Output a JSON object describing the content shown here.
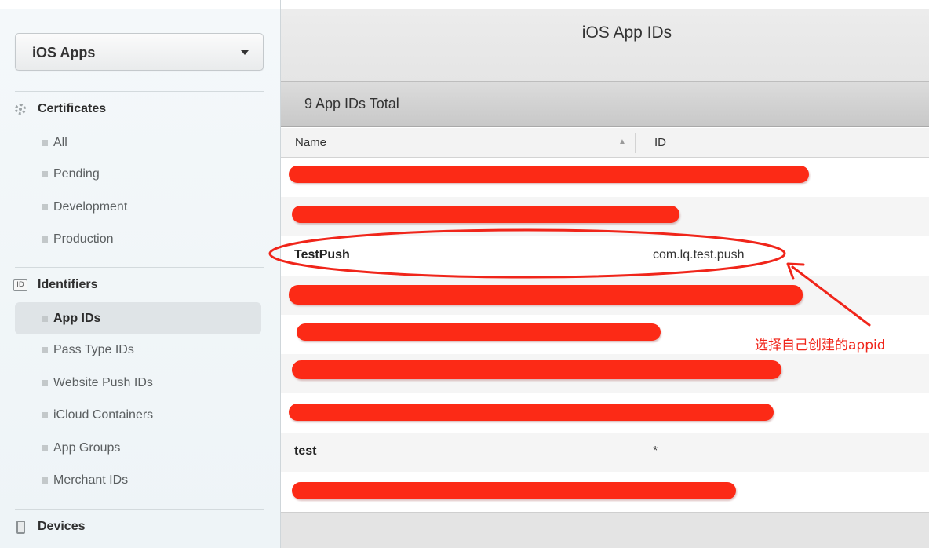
{
  "sidebar": {
    "dropdown": {
      "label": "iOS Apps"
    },
    "sections": [
      {
        "title": "Certificates",
        "icon": "certificate-gear-icon",
        "items": [
          {
            "label": "All"
          },
          {
            "label": "Pending"
          },
          {
            "label": "Development"
          },
          {
            "label": "Production"
          }
        ]
      },
      {
        "title": "Identifiers",
        "icon": "id-badge-icon",
        "icon_text": "ID",
        "items": [
          {
            "label": "App IDs",
            "active": true
          },
          {
            "label": "Pass Type IDs"
          },
          {
            "label": "Website Push IDs"
          },
          {
            "label": "iCloud Containers"
          },
          {
            "label": "App Groups"
          },
          {
            "label": "Merchant IDs"
          }
        ]
      },
      {
        "title": "Devices",
        "icon": "device-icon"
      }
    ]
  },
  "main": {
    "title": "iOS App IDs",
    "count_label": "9 App IDs Total",
    "columns": {
      "name": "Name",
      "id": "ID",
      "sort_indicator": "▲"
    },
    "rows": [
      {
        "name": "",
        "id": "",
        "redacted": true
      },
      {
        "name": "",
        "id": "",
        "redacted": true
      },
      {
        "name": "TestPush",
        "id": "com.lq.test.push",
        "highlighted": true
      },
      {
        "name": "",
        "id": "",
        "redacted": true
      },
      {
        "name": "",
        "id": "",
        "redacted": true
      },
      {
        "name": "",
        "id": "",
        "redacted": true
      },
      {
        "name": "",
        "id": "",
        "redacted": true
      },
      {
        "name": "test",
        "id": "*"
      },
      {
        "name": "",
        "id": "",
        "redacted": true
      }
    ]
  },
  "annotation": {
    "text": "选择自己创建的appid",
    "color": "#f0251a"
  },
  "colors": {
    "redaction": "#fc2a16",
    "sidebar_bg": "#f1f6f8",
    "active_item_bg": "#dfe4e7"
  }
}
